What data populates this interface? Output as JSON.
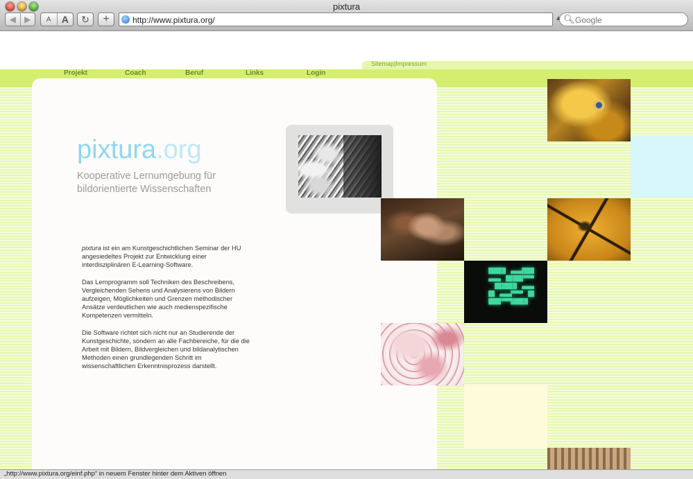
{
  "window": {
    "title": "pixtura"
  },
  "toolbar": {
    "back_icon": "◀",
    "forward_icon": "▶",
    "text_smaller": "A",
    "text_bigger": "A",
    "reload_icon": "↻",
    "add_icon": "+",
    "url": "http://www.pixtura.org/",
    "search_placeholder": "Google"
  },
  "page": {
    "top_links": {
      "sitemap": "Sitemap",
      "separator": "|",
      "impressum": "Impressum"
    },
    "menu": [
      "Projekt",
      "Coach",
      "Beruf",
      "Links",
      "Login"
    ],
    "logo": {
      "main": "pixtura",
      "suffix": ".org"
    },
    "tagline": "Kooperative Lernumgebung für bildorientierte Wissenschaften",
    "intro": {
      "p1_emphasis": "pixtura",
      "p1_rest": " ist ein am Kunstgeschichtlichen Seminar der HU angesiedeltes Projekt zur Entwicklung einer interdisziplinären E-Learning-Software.",
      "p2": "Das Lernprogramm soll Techniken des Beschreibens, Vergleichenden Sehens und Analysierens von Bildern aufzeigen, Möglichkeiten und Grenzen methodischer Ansätze verdeutlichen wie auch medienspezifische Kompetenzen vermitteln.",
      "p3": "Die Software richtet sich nicht nur an Studierende der Kunstgeschichte, sondern an alle Fachbereiche, für die die Arbeit mit Bildern, Bildvergleichen und bildanalytischen Methoden einen grundlegenden Schritt im wissenschaftlichen Erkenntnisprozess darstellt."
    },
    "colors": {
      "menu_bar": "#d4ee70",
      "stripe": "#e7f7b0",
      "logo": "#8fd7f3",
      "link": "#6a8a2a"
    }
  },
  "statusbar": {
    "text": "„http://www.pixtura.org/einf.php“ in neuem Fenster hinter dem Aktiven öffnen"
  }
}
